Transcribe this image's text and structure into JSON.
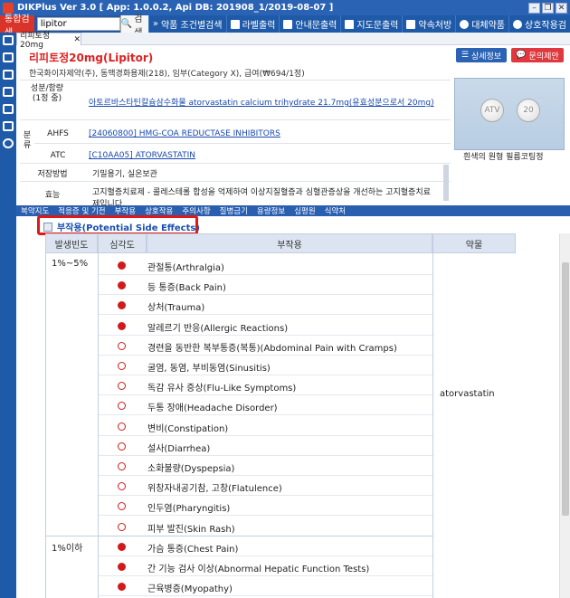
{
  "window": {
    "title": "DIKPlus Ver 3.0 [ App: 1.0.0.2, Api DB: 201908_1/2019-08-07 ]"
  },
  "toolbar": {
    "mode": "통합검색",
    "search_value": "lipitor",
    "search_btn": "검색",
    "buttons": [
      "약품 조건별검색",
      "라벨출력",
      "안내문출력",
      "지도문출력",
      "약속처방",
      "대체약품",
      "상호작용검"
    ]
  },
  "tab": {
    "label": "리피토정20mg",
    "close": "✕"
  },
  "drug": {
    "name": "리피토정20mg(Lipitor)",
    "maker": "한국화이자제약(주), 동맥경화용제(218), 임부(Category X), 급여(₩694/1정)",
    "detail_btn": "상세정보",
    "inquiry_btn": "문의제안",
    "pill_marks": [
      "ATV",
      "20"
    ],
    "pill_note": "흰색의 원형 필름코팅정"
  },
  "info": {
    "ingredient_label": "성분/함량\n(1정 중)",
    "ingredient_value": "아토르바스타틴칼슘삼수화물 atorvastatin calcium trihydrate 21.7mg(유효성분으로서 20mg)",
    "class_label": "분류",
    "ahfs_label": "AHFS",
    "ahfs_value": "[24060800] HMG-COA REDUCTASE INHIBITORS",
    "atc_label": "ATC",
    "atc_value": "[C10AA05] ATORVASTATIN",
    "storage_label": "저장방법",
    "storage_value": "기밀용기, 실온보관",
    "effect_label": "효능",
    "effect_value": "고지혈증치료제 - 콜레스테롤 합성을 억제하여 이상지질혈증과 심혈관증상을 개선하는 고지혈증치료제입니다."
  },
  "section_nav": [
    "복약지도",
    "적응증 및 기전",
    "부작용",
    "상호작용",
    "주의사항",
    "질병금기",
    "용량정보",
    "심평원",
    "식약처"
  ],
  "side_effects": {
    "title": "부작용(Potential Side Effects)",
    "headers": [
      "발생빈도",
      "심각도",
      "부작용",
      "약물"
    ],
    "drug": "atorvastatin",
    "groups": [
      {
        "freq": "1%~5%",
        "items": [
          {
            "name": "관절통(Arthralgia)",
            "severe": true
          },
          {
            "name": "등 통증(Back Pain)",
            "severe": true
          },
          {
            "name": "상처(Trauma)",
            "severe": true
          },
          {
            "name": "알레르기 반응(Allergic Reactions)",
            "severe": true
          },
          {
            "name": "경련을 동반한 복부통증(복통)(Abdominal Pain with Cramps)",
            "severe": false
          },
          {
            "name": "굴염, 동염, 부비동염(Sinusitis)",
            "severe": false
          },
          {
            "name": "독감 유사 증상(Flu-Like Symptoms)",
            "severe": false
          },
          {
            "name": "두통 장애(Headache Disorder)",
            "severe": false
          },
          {
            "name": "변비(Constipation)",
            "severe": false
          },
          {
            "name": "설사(Diarrhea)",
            "severe": false
          },
          {
            "name": "소화불량(Dyspepsia)",
            "severe": false
          },
          {
            "name": "위창자내공기참, 고창(Flatulence)",
            "severe": false
          },
          {
            "name": "인두염(Pharyngitis)",
            "severe": false
          },
          {
            "name": "피부 발진(Skin Rash)",
            "severe": false
          }
        ]
      },
      {
        "freq": "1%이하",
        "items": [
          {
            "name": "가슴 통증(Chest Pain)",
            "severe": true
          },
          {
            "name": "간 기능 검사 이상(Abnormal Hepatic Function Tests)",
            "severe": true
          },
          {
            "name": "근육병증(Myopathy)",
            "severe": true
          }
        ]
      }
    ]
  }
}
